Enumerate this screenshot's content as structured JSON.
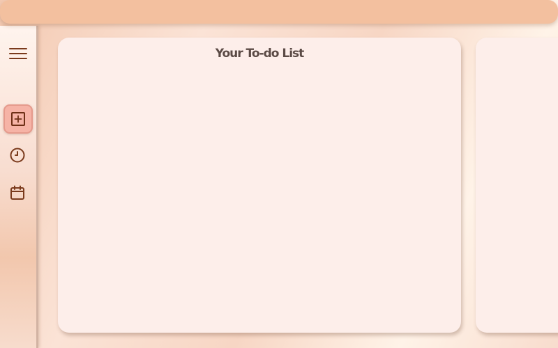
{
  "colors": {
    "topbar": "#f3c09f",
    "panel": "#fdeeea",
    "active_button": "#f6b3a6",
    "icon": "#7a3a1c",
    "title_text": "#5b4a45"
  },
  "sidebar": {
    "items": [
      {
        "icon": "hamburger-menu-icon",
        "active": false
      },
      {
        "icon": "add-square-icon",
        "active": true
      },
      {
        "icon": "clock-icon",
        "active": false
      },
      {
        "icon": "calendar-icon",
        "active": false
      }
    ]
  },
  "todo_panel": {
    "title": "Your To-do List"
  }
}
